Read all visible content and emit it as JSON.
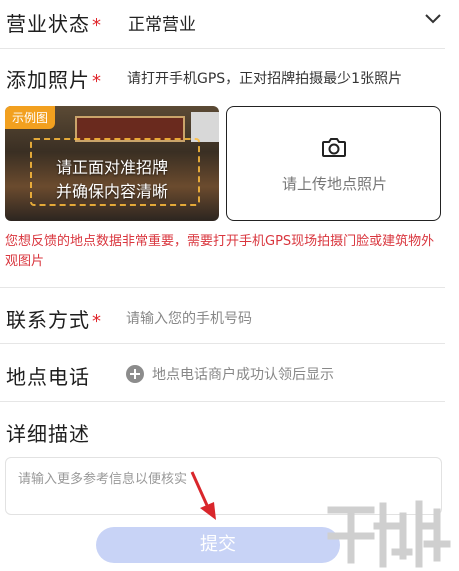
{
  "status": {
    "label": "营业状态",
    "required_mark": "*",
    "value": "正常营业"
  },
  "photo": {
    "label": "添加照片",
    "required_mark": "*",
    "hint": "请打开手机GPS，正对招牌拍摄最少1张照片",
    "example": {
      "tag": "示例图",
      "line1": "请正面对准招牌",
      "line2": "并确保内容清晰"
    },
    "upload": {
      "text": "请上传地点照片",
      "icon": "camera-icon"
    },
    "warning": "您想反馈的地点数据非常重要，需要打开手机GPS现场拍摄门脸或建筑物外观图片"
  },
  "contact": {
    "label": "联系方式",
    "required_mark": "*",
    "placeholder": "请输入您的手机号码"
  },
  "phone": {
    "label": "地点电话",
    "hint": "地点电话商户成功认领后显示",
    "icon": "plus-circle-icon"
  },
  "description": {
    "label": "详细描述",
    "placeholder": "请输入更多参考信息以便核实"
  },
  "submit": {
    "label": "提交"
  },
  "colors": {
    "accent_red": "#e0262b",
    "submit_bg": "#c8d3f6",
    "example_tag": "#f2a01f"
  }
}
